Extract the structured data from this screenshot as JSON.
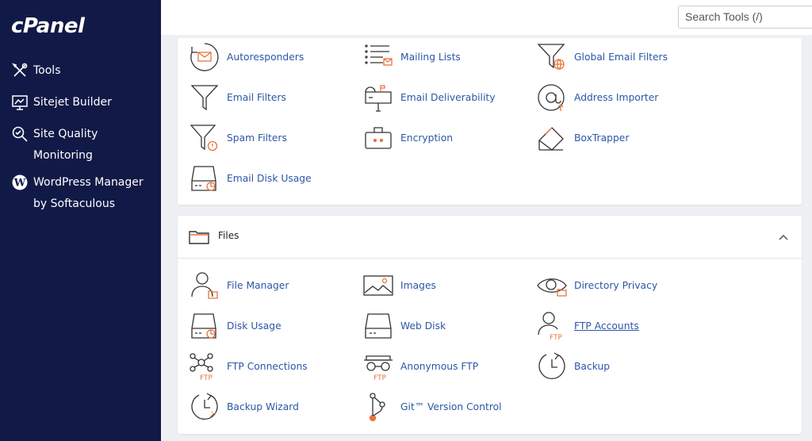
{
  "brand": {
    "logo": "cPanel"
  },
  "sidebar": {
    "items": [
      {
        "label": "Tools",
        "icon": "tools-icon"
      },
      {
        "label": "Sitejet Builder",
        "icon": "monitor-icon"
      },
      {
        "label": "Site Quality Monitoring",
        "icon": "search-check-icon"
      },
      {
        "label": "WordPress Manager by Softaculous",
        "icon": "wordpress-icon"
      }
    ]
  },
  "search": {
    "placeholder": "Search Tools (/)"
  },
  "email": {
    "tools": [
      {
        "label": "Autoresponders",
        "icon": "autoresponder-icon"
      },
      {
        "label": "Mailing Lists",
        "icon": "mailing-list-icon"
      },
      {
        "label": "Global Email Filters",
        "icon": "global-filter-icon"
      },
      {
        "label": "Email Filters",
        "icon": "filter-icon"
      },
      {
        "label": "Email Deliverability",
        "icon": "mailbox-icon"
      },
      {
        "label": "Address Importer",
        "icon": "at-import-icon"
      },
      {
        "label": "Spam Filters",
        "icon": "spam-filter-icon"
      },
      {
        "label": "Encryption",
        "icon": "encryption-icon"
      },
      {
        "label": "BoxTrapper",
        "icon": "boxtrapper-icon"
      },
      {
        "label": "Email Disk Usage",
        "icon": "disk-usage-icon"
      }
    ]
  },
  "files": {
    "title": "Files",
    "tools": [
      {
        "label": "File Manager",
        "icon": "file-manager-icon"
      },
      {
        "label": "Images",
        "icon": "images-icon"
      },
      {
        "label": "Directory Privacy",
        "icon": "eye-icon"
      },
      {
        "label": "Disk Usage",
        "icon": "disk-usage-icon"
      },
      {
        "label": "Web Disk",
        "icon": "web-disk-icon"
      },
      {
        "label": "FTP Accounts",
        "icon": "ftp-accounts-icon"
      },
      {
        "label": "FTP Connections",
        "icon": "ftp-connections-icon"
      },
      {
        "label": "Anonymous FTP",
        "icon": "anonymous-ftp-icon"
      },
      {
        "label": "Backup",
        "icon": "backup-icon"
      },
      {
        "label": "Backup Wizard",
        "icon": "backup-wizard-icon"
      },
      {
        "label": "Git™ Version Control",
        "icon": "git-icon"
      }
    ]
  },
  "colors": {
    "sidebar": "#111a47",
    "link": "#2b57a6",
    "accent": "#e8743b"
  }
}
